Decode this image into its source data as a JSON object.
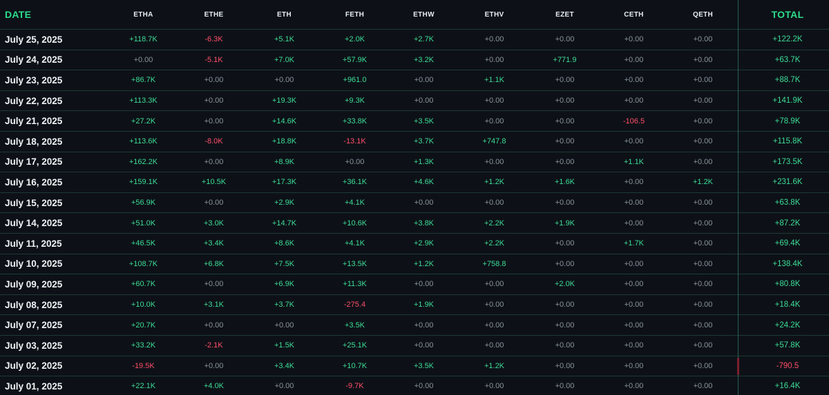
{
  "columns": {
    "date": "DATE",
    "funds": [
      "ETHA",
      "ETHE",
      "ETH",
      "FETH",
      "ETHW",
      "ETHV",
      "EZET",
      "CETH",
      "QETH"
    ],
    "total": "TOTAL"
  },
  "rows": [
    {
      "date": "July 25, 2025",
      "values": [
        "+118.7K",
        "-6.3K",
        "+5.1K",
        "+2.0K",
        "+2.7K",
        "+0.00",
        "+0.00",
        "+0.00",
        "+0.00"
      ],
      "total": "+122.2K"
    },
    {
      "date": "July 24, 2025",
      "values": [
        "+0.00",
        "-5.1K",
        "+7.0K",
        "+57.9K",
        "+3.2K",
        "+0.00",
        "+771.9",
        "+0.00",
        "+0.00"
      ],
      "total": "+63.7K"
    },
    {
      "date": "July 23, 2025",
      "values": [
        "+86.7K",
        "+0.00",
        "+0.00",
        "+961.0",
        "+0.00",
        "+1.1K",
        "+0.00",
        "+0.00",
        "+0.00"
      ],
      "total": "+88.7K"
    },
    {
      "date": "July 22, 2025",
      "values": [
        "+113.3K",
        "+0.00",
        "+19.3K",
        "+9.3K",
        "+0.00",
        "+0.00",
        "+0.00",
        "+0.00",
        "+0.00"
      ],
      "total": "+141.9K"
    },
    {
      "date": "July 21, 2025",
      "values": [
        "+27.2K",
        "+0.00",
        "+14.6K",
        "+33.8K",
        "+3.5K",
        "+0.00",
        "+0.00",
        "-106.5",
        "+0.00"
      ],
      "total": "+78.9K"
    },
    {
      "date": "July 18, 2025",
      "values": [
        "+113.6K",
        "-8.0K",
        "+18.8K",
        "-13.1K",
        "+3.7K",
        "+747.8",
        "+0.00",
        "+0.00",
        "+0.00"
      ],
      "total": "+115.8K"
    },
    {
      "date": "July 17, 2025",
      "values": [
        "+162.2K",
        "+0.00",
        "+8.9K",
        "+0.00",
        "+1.3K",
        "+0.00",
        "+0.00",
        "+1.1K",
        "+0.00"
      ],
      "total": "+173.5K"
    },
    {
      "date": "July 16, 2025",
      "values": [
        "+159.1K",
        "+10.5K",
        "+17.3K",
        "+36.1K",
        "+4.6K",
        "+1.2K",
        "+1.6K",
        "+0.00",
        "+1.2K"
      ],
      "total": "+231.6K"
    },
    {
      "date": "July 15, 2025",
      "values": [
        "+56.9K",
        "+0.00",
        "+2.9K",
        "+4.1K",
        "+0.00",
        "+0.00",
        "+0.00",
        "+0.00",
        "+0.00"
      ],
      "total": "+63.8K"
    },
    {
      "date": "July 14, 2025",
      "values": [
        "+51.0K",
        "+3.0K",
        "+14.7K",
        "+10.6K",
        "+3.8K",
        "+2.2K",
        "+1.9K",
        "+0.00",
        "+0.00"
      ],
      "total": "+87.2K"
    },
    {
      "date": "July 11, 2025",
      "values": [
        "+46.5K",
        "+3.4K",
        "+8.6K",
        "+4.1K",
        "+2.9K",
        "+2.2K",
        "+0.00",
        "+1.7K",
        "+0.00"
      ],
      "total": "+69.4K"
    },
    {
      "date": "July 10, 2025",
      "values": [
        "+108.7K",
        "+6.8K",
        "+7.5K",
        "+13.5K",
        "+1.2K",
        "+758.8",
        "+0.00",
        "+0.00",
        "+0.00"
      ],
      "total": "+138.4K"
    },
    {
      "date": "July 09, 2025",
      "values": [
        "+60.7K",
        "+0.00",
        "+6.9K",
        "+11.3K",
        "+0.00",
        "+0.00",
        "+2.0K",
        "+0.00",
        "+0.00"
      ],
      "total": "+80.8K"
    },
    {
      "date": "July 08, 2025",
      "values": [
        "+10.0K",
        "+3.1K",
        "+3.7K",
        "-275.4",
        "+1.9K",
        "+0.00",
        "+0.00",
        "+0.00",
        "+0.00"
      ],
      "total": "+18.4K"
    },
    {
      "date": "July 07, 2025",
      "values": [
        "+20.7K",
        "+0.00",
        "+0.00",
        "+3.5K",
        "+0.00",
        "+0.00",
        "+0.00",
        "+0.00",
        "+0.00"
      ],
      "total": "+24.2K"
    },
    {
      "date": "July 03, 2025",
      "values": [
        "+33.2K",
        "-2.1K",
        "+1.5K",
        "+25.1K",
        "+0.00",
        "+0.00",
        "+0.00",
        "+0.00",
        "+0.00"
      ],
      "total": "+57.8K"
    },
    {
      "date": "July 02, 2025",
      "values": [
        "-19.5K",
        "+0.00",
        "+3.4K",
        "+10.7K",
        "+3.5K",
        "+1.2K",
        "+0.00",
        "+0.00",
        "+0.00"
      ],
      "total": "-790.5"
    },
    {
      "date": "July 01, 2025",
      "values": [
        "+22.1K",
        "+4.0K",
        "+0.00",
        "-9.7K",
        "+0.00",
        "+0.00",
        "+0.00",
        "+0.00",
        "+0.00"
      ],
      "total": "+16.4K"
    }
  ],
  "colors": {
    "background": "#0d1117",
    "positive": "#3ddc97",
    "negative": "#ff4d6a",
    "zero": "#8b949e",
    "header_accent": "#2ddc8c",
    "grid_line": "#1d3a34"
  }
}
